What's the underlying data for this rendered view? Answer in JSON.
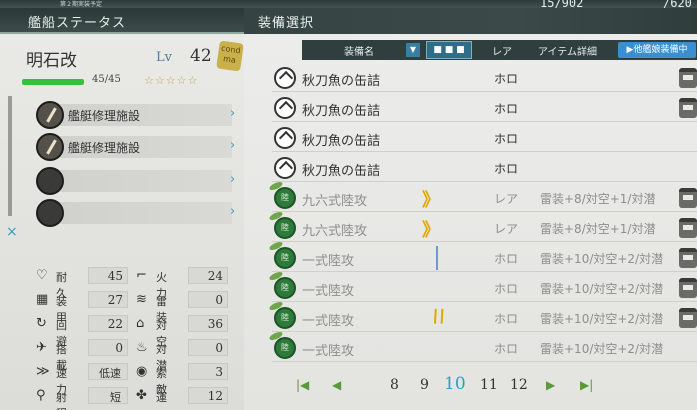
{
  "top": {
    "subtitle": "第２期実装予定",
    "resource1": "15/902",
    "resource2": "/620"
  },
  "left_header": {
    "title": "艦船ステータス"
  },
  "right_header": {
    "title": "装備選択"
  },
  "ship": {
    "name": "明石改",
    "lv_label": "Lv",
    "level": "42",
    "cond_badge": "cond ma",
    "hp_text": "45/45",
    "hp_fraction": 1.0,
    "stars": "☆☆☆☆☆"
  },
  "slots": [
    {
      "label": "艦艇修理施設",
      "icon": "wrench-icon"
    },
    {
      "label": "艦艇修理施設",
      "icon": "wrench-icon"
    },
    {
      "label": "",
      "icon": "empty-slot-icon"
    },
    {
      "label": "",
      "icon": "empty-slot-icon"
    }
  ],
  "slot_arrow": "›",
  "close_mark": "×",
  "stats": [
    {
      "icon": "♡",
      "label": "耐久",
      "value": "45"
    },
    {
      "icon": "⌐",
      "label": "火力",
      "value": "24"
    },
    {
      "icon": "▦",
      "label": "装甲",
      "value": "27"
    },
    {
      "icon": "≋",
      "label": "雷装",
      "value": "0"
    },
    {
      "icon": "↻",
      "label": "回避",
      "value": "22"
    },
    {
      "icon": "⌂",
      "label": "対空",
      "value": "36"
    },
    {
      "icon": "✈",
      "label": "搭載",
      "value": "0"
    },
    {
      "icon": "♨",
      "label": "対潜",
      "value": "0"
    },
    {
      "icon": "≫",
      "label": "速力",
      "value": "低速"
    },
    {
      "icon": "◉",
      "label": "索敵",
      "value": "3"
    },
    {
      "icon": "⚲",
      "label": "射程",
      "value": "短"
    },
    {
      "icon": "✤",
      "label": "運",
      "value": "12"
    }
  ],
  "columns": {
    "name": "装備名",
    "sort": "▼",
    "view": "■ ■ ■",
    "rarity": "レア",
    "detail": "アイテム詳細",
    "other_ships": "▶他艦娘装備中"
  },
  "items": [
    {
      "name": "秋刀魚の缶詰",
      "icon": "can-icon",
      "rarity": "ホロ",
      "detail": "",
      "proficiency": "",
      "locked": true,
      "dim": false
    },
    {
      "name": "秋刀魚の缶詰",
      "icon": "can-icon",
      "rarity": "ホロ",
      "detail": "",
      "proficiency": "",
      "locked": true,
      "dim": false
    },
    {
      "name": "秋刀魚の缶詰",
      "icon": "can-icon",
      "rarity": "ホロ",
      "detail": "",
      "proficiency": "",
      "locked": false,
      "dim": false
    },
    {
      "name": "秋刀魚の缶詰",
      "icon": "can-icon",
      "rarity": "ホロ",
      "detail": "",
      "proficiency": "",
      "locked": false,
      "dim": false
    },
    {
      "name": "九六式陸攻",
      "icon": "land-plane-icon",
      "rarity": "レア",
      "detail": "雷装+8/対空+1/対潜",
      "proficiency": "double-chevron",
      "locked": true,
      "dim": true
    },
    {
      "name": "九六式陸攻",
      "icon": "land-plane-icon",
      "rarity": "レア",
      "detail": "雷装+8/対空+1/対潜",
      "proficiency": "double-chevron",
      "locked": true,
      "dim": true
    },
    {
      "name": "一式陸攻",
      "icon": "land-plane-icon",
      "rarity": "ホロ",
      "detail": "雷装+10/対空+2/対潜",
      "proficiency": "single-line",
      "locked": true,
      "dim": true
    },
    {
      "name": "一式陸攻",
      "icon": "land-plane-icon",
      "rarity": "ホロ",
      "detail": "雷装+10/対空+2/対潜",
      "proficiency": "",
      "locked": true,
      "dim": true
    },
    {
      "name": "一式陸攻",
      "icon": "land-plane-icon",
      "rarity": "ホロ",
      "detail": "雷装+10/対空+2/対潜",
      "proficiency": "double-line",
      "locked": true,
      "dim": true
    },
    {
      "name": "一式陸攻",
      "icon": "land-plane-icon",
      "rarity": "ホロ",
      "detail": "雷装+10/対空+2/対潜",
      "proficiency": "",
      "locked": false,
      "dim": true
    }
  ],
  "plane_badge": "陸",
  "pager": {
    "first": "|◀",
    "prev": "◀",
    "pages": [
      "8",
      "9",
      "10",
      "11",
      "12"
    ],
    "current": "10",
    "next": "▶",
    "last": "▶|"
  }
}
